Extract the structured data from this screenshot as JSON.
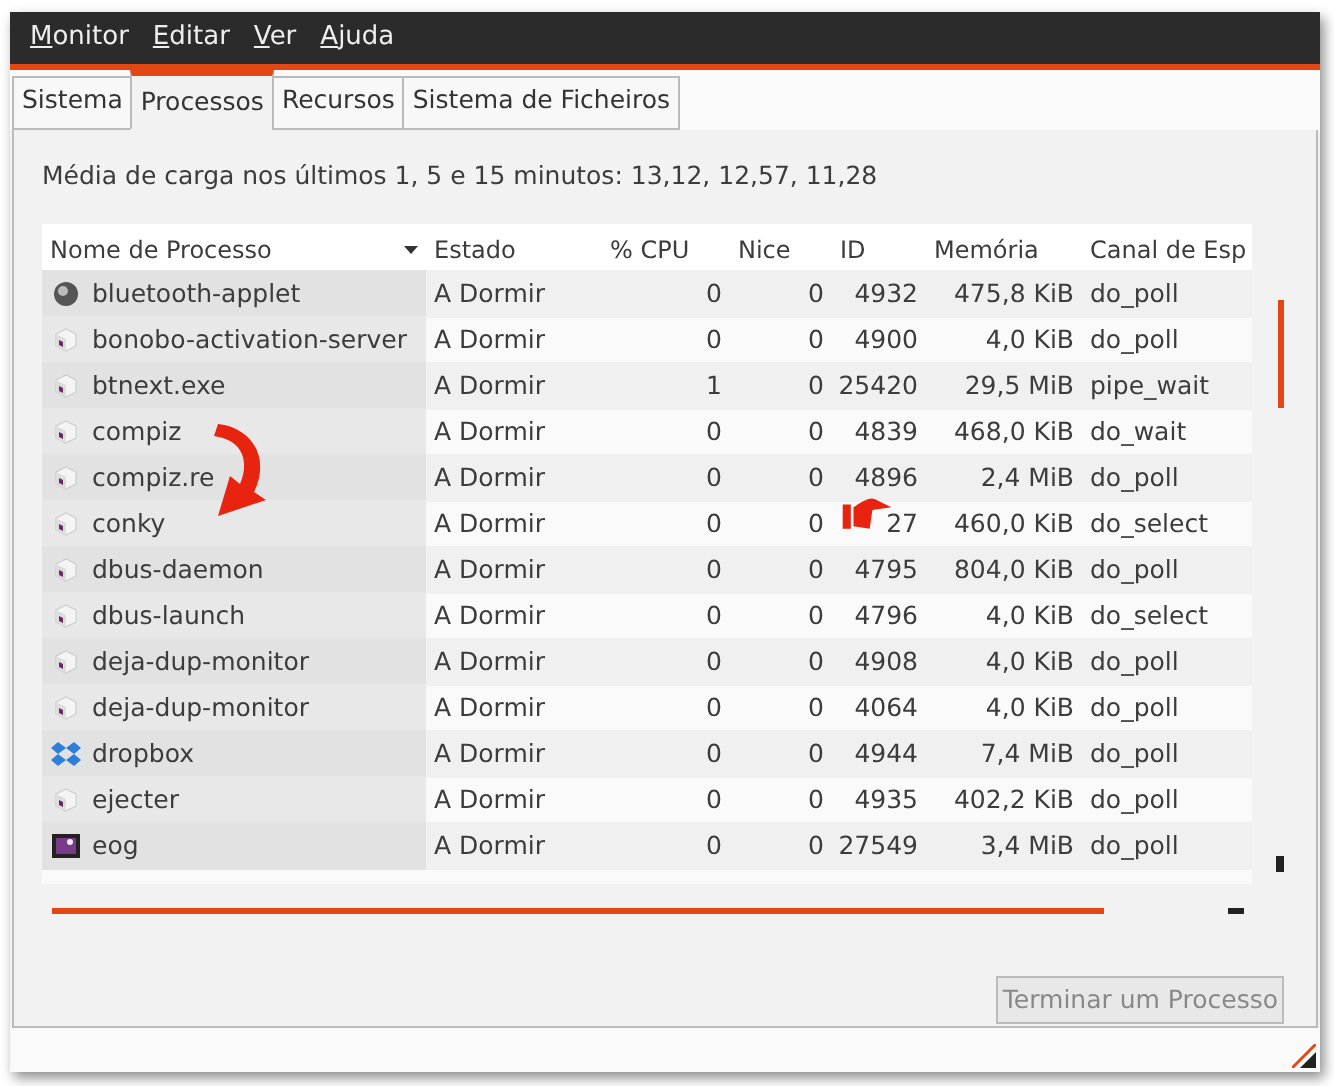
{
  "menu": [
    {
      "label": "Monitor"
    },
    {
      "label": "Editar"
    },
    {
      "label": "Ver"
    },
    {
      "label": "Ajuda"
    }
  ],
  "tabs": [
    {
      "label": "Sistema",
      "selected": false
    },
    {
      "label": "Processos",
      "selected": true
    },
    {
      "label": "Recursos",
      "selected": false
    },
    {
      "label": "Sistema de Ficheiros",
      "selected": false
    }
  ],
  "load_average": "Média de carga nos últimos 1, 5 e 15 minutos: 13,12, 12,57, 11,28",
  "table": {
    "columns": [
      {
        "label": "Nome de Processo",
        "sorted": true
      },
      {
        "label": "Estado",
        "sorted": false
      },
      {
        "label": "% CPU",
        "sorted": false
      },
      {
        "label": "Nice",
        "sorted": false
      },
      {
        "label": "ID",
        "sorted": false
      },
      {
        "label": "Memória",
        "sorted": false
      },
      {
        "label": "Canal de Esp",
        "sorted": false
      }
    ],
    "rows": [
      {
        "kind": "bluetooth",
        "cells": [
          "bluetooth-applet",
          "A Dormir",
          "0",
          "0",
          "4932",
          "475,8 KiB",
          "do_poll"
        ]
      },
      {
        "kind": "generic",
        "cells": [
          "bonobo-activation-server",
          "A Dormir",
          "0",
          "0",
          "4900",
          "4,0 KiB",
          "do_poll"
        ]
      },
      {
        "kind": "generic",
        "cells": [
          "btnext.exe",
          "A Dormir",
          "1",
          "0",
          "25420",
          "29,5 MiB",
          "pipe_wait"
        ]
      },
      {
        "kind": "generic",
        "cells": [
          "compiz",
          "A Dormir",
          "0",
          "0",
          "4839",
          "468,0 KiB",
          "do_wait"
        ]
      },
      {
        "kind": "generic",
        "cells": [
          "compiz.re",
          "A Dormir",
          "0",
          "0",
          "4896",
          "2,4 MiB",
          "do_poll"
        ]
      },
      {
        "kind": "generic",
        "cells": [
          "conky",
          "A Dormir",
          "0",
          "0",
          "27",
          "460,0 KiB",
          "do_select"
        ]
      },
      {
        "kind": "generic",
        "cells": [
          "dbus-daemon",
          "A Dormir",
          "0",
          "0",
          "4795",
          "804,0 KiB",
          "do_poll"
        ]
      },
      {
        "kind": "generic",
        "cells": [
          "dbus-launch",
          "A Dormir",
          "0",
          "0",
          "4796",
          "4,0 KiB",
          "do_select"
        ]
      },
      {
        "kind": "generic",
        "cells": [
          "deja-dup-monitor",
          "A Dormir",
          "0",
          "0",
          "4908",
          "4,0 KiB",
          "do_poll"
        ]
      },
      {
        "kind": "generic",
        "cells": [
          "deja-dup-monitor",
          "A Dormir",
          "0",
          "0",
          "4064",
          "4,0 KiB",
          "do_poll"
        ]
      },
      {
        "kind": "dropbox",
        "cells": [
          "dropbox",
          "A Dormir",
          "0",
          "0",
          "4944",
          "7,4 MiB",
          "do_poll"
        ]
      },
      {
        "kind": "generic",
        "cells": [
          "ejecter",
          "A Dormir",
          "0",
          "0",
          "4935",
          "402,2 KiB",
          "do_poll"
        ]
      },
      {
        "kind": "image",
        "cells": [
          "eog",
          "A Dormir",
          "0",
          "0",
          "27549",
          "3,4 MiB",
          "do_poll"
        ]
      }
    ]
  },
  "end_button": {
    "label": "Terminar um Processo",
    "disabled": true
  }
}
